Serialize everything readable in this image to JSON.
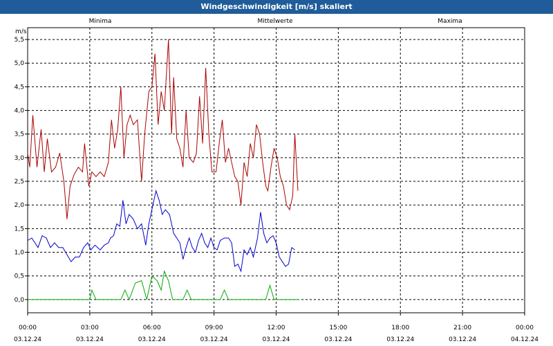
{
  "window": {
    "title": "Windgeschwindigkeit [m/s] skaliert"
  },
  "colors": {
    "titlebar": "#1f5c99",
    "minima": "#00aa00",
    "mittel": "#0000cc",
    "maxima": "#aa0000",
    "grid": "#000000"
  },
  "chart_data": {
    "type": "line",
    "title": "Windgeschwindigkeit [m/s] skaliert",
    "ylabel": "m/s",
    "xlabel": "",
    "ylim": [
      -0.28,
      5.75
    ],
    "xlim": [
      0,
      24
    ],
    "grid": true,
    "legend_placement": "top",
    "y_ticks": [
      "0,0",
      "0,5",
      "1,0",
      "1,5",
      "2,0",
      "2,5",
      "3,0",
      "3,5",
      "4,0",
      "4,5",
      "5,0",
      "5,5"
    ],
    "y_tick_values": [
      0,
      0.5,
      1,
      1.5,
      2,
      2.5,
      3,
      3.5,
      4,
      4.5,
      5,
      5.5
    ],
    "x_ticks": [
      {
        "time": "00:00",
        "date": "03.12.24"
      },
      {
        "time": "03:00",
        "date": "03.12.24"
      },
      {
        "time": "06:00",
        "date": "03.12.24"
      },
      {
        "time": "09:00",
        "date": "03.12.24"
      },
      {
        "time": "12:00",
        "date": "03.12.24"
      },
      {
        "time": "15:00",
        "date": "03.12.24"
      },
      {
        "time": "18:00",
        "date": "03.12.24"
      },
      {
        "time": "21:00",
        "date": "03.12.24"
      },
      {
        "time": "00:00",
        "date": "04.12.24"
      }
    ],
    "x_tick_values": [
      0,
      3,
      6,
      9,
      12,
      15,
      18,
      21,
      24
    ],
    "series": [
      {
        "name": "Minima",
        "color": "#00aa00",
        "points": [
          [
            0,
            0
          ],
          [
            3,
            0
          ],
          [
            3.1,
            0.2
          ],
          [
            3.3,
            0
          ],
          [
            4.5,
            0
          ],
          [
            4.7,
            0.2
          ],
          [
            4.9,
            0
          ],
          [
            5.2,
            0.35
          ],
          [
            5.5,
            0.4
          ],
          [
            5.75,
            0
          ],
          [
            6.0,
            0.5
          ],
          [
            6.25,
            0.4
          ],
          [
            6.45,
            0.2
          ],
          [
            6.6,
            0.6
          ],
          [
            6.8,
            0.4
          ],
          [
            7.0,
            0
          ],
          [
            7.5,
            0
          ],
          [
            7.7,
            0.2
          ],
          [
            7.9,
            0
          ],
          [
            9.3,
            0
          ],
          [
            9.5,
            0.2
          ],
          [
            9.7,
            0
          ],
          [
            11.5,
            0
          ],
          [
            11.7,
            0.3
          ],
          [
            11.9,
            0
          ],
          [
            13.1,
            0
          ]
        ]
      },
      {
        "name": "Mittelwerte",
        "color": "#0000cc",
        "points": [
          [
            0,
            1.25
          ],
          [
            0.2,
            1.3
          ],
          [
            0.35,
            1.2
          ],
          [
            0.5,
            1.1
          ],
          [
            0.7,
            1.35
          ],
          [
            0.9,
            1.3
          ],
          [
            1.1,
            1.1
          ],
          [
            1.3,
            1.2
          ],
          [
            1.5,
            1.1
          ],
          [
            1.7,
            1.1
          ],
          [
            1.9,
            0.95
          ],
          [
            2.1,
            0.8
          ],
          [
            2.3,
            0.9
          ],
          [
            2.5,
            0.9
          ],
          [
            2.7,
            1.1
          ],
          [
            2.9,
            1.2
          ],
          [
            3.05,
            1.05
          ],
          [
            3.25,
            1.15
          ],
          [
            3.5,
            1.05
          ],
          [
            3.7,
            1.15
          ],
          [
            3.9,
            1.2
          ],
          [
            4.0,
            1.3
          ],
          [
            4.15,
            1.35
          ],
          [
            4.3,
            1.6
          ],
          [
            4.45,
            1.55
          ],
          [
            4.6,
            2.1
          ],
          [
            4.75,
            1.6
          ],
          [
            4.9,
            1.8
          ],
          [
            5.1,
            1.7
          ],
          [
            5.3,
            1.5
          ],
          [
            5.5,
            1.6
          ],
          [
            5.7,
            1.15
          ],
          [
            5.85,
            1.6
          ],
          [
            6.05,
            2.0
          ],
          [
            6.2,
            2.3
          ],
          [
            6.35,
            2.1
          ],
          [
            6.5,
            1.8
          ],
          [
            6.65,
            1.9
          ],
          [
            6.85,
            1.8
          ],
          [
            7.05,
            1.4
          ],
          [
            7.2,
            1.3
          ],
          [
            7.35,
            1.2
          ],
          [
            7.5,
            0.85
          ],
          [
            7.65,
            1.1
          ],
          [
            7.8,
            1.3
          ],
          [
            7.95,
            1.1
          ],
          [
            8.1,
            1.0
          ],
          [
            8.25,
            1.25
          ],
          [
            8.4,
            1.4
          ],
          [
            8.55,
            1.2
          ],
          [
            8.7,
            1.1
          ],
          [
            8.85,
            1.3
          ],
          [
            9.0,
            1.1
          ],
          [
            9.15,
            1.05
          ],
          [
            9.3,
            1.25
          ],
          [
            9.5,
            1.3
          ],
          [
            9.7,
            1.3
          ],
          [
            9.85,
            1.2
          ],
          [
            10.0,
            0.7
          ],
          [
            10.15,
            0.75
          ],
          [
            10.3,
            0.6
          ],
          [
            10.45,
            1.05
          ],
          [
            10.6,
            0.95
          ],
          [
            10.75,
            1.1
          ],
          [
            10.9,
            0.9
          ],
          [
            11.1,
            1.3
          ],
          [
            11.25,
            1.85
          ],
          [
            11.4,
            1.4
          ],
          [
            11.55,
            1.2
          ],
          [
            11.7,
            1.3
          ],
          [
            11.85,
            1.35
          ],
          [
            12.0,
            1.2
          ],
          [
            12.15,
            0.9
          ],
          [
            12.3,
            0.8
          ],
          [
            12.45,
            0.7
          ],
          [
            12.6,
            0.75
          ],
          [
            12.75,
            1.1
          ],
          [
            12.9,
            1.05
          ]
        ]
      },
      {
        "name": "Maxima",
        "color": "#aa0000",
        "points": [
          [
            0,
            3.1
          ],
          [
            0.1,
            2.8
          ],
          [
            0.25,
            3.9
          ],
          [
            0.45,
            2.8
          ],
          [
            0.65,
            3.6
          ],
          [
            0.8,
            2.7
          ],
          [
            0.95,
            3.4
          ],
          [
            1.15,
            2.7
          ],
          [
            1.35,
            2.8
          ],
          [
            1.55,
            3.1
          ],
          [
            1.75,
            2.5
          ],
          [
            1.9,
            1.7
          ],
          [
            2.05,
            2.4
          ],
          [
            2.25,
            2.65
          ],
          [
            2.45,
            2.8
          ],
          [
            2.65,
            2.7
          ],
          [
            2.75,
            3.3
          ],
          [
            2.95,
            2.4
          ],
          [
            3.1,
            2.7
          ],
          [
            3.3,
            2.6
          ],
          [
            3.5,
            2.7
          ],
          [
            3.7,
            2.6
          ],
          [
            3.9,
            2.9
          ],
          [
            4.05,
            3.8
          ],
          [
            4.2,
            3.2
          ],
          [
            4.35,
            3.6
          ],
          [
            4.5,
            4.5
          ],
          [
            4.65,
            3.0
          ],
          [
            4.8,
            3.7
          ],
          [
            4.95,
            3.9
          ],
          [
            5.1,
            3.7
          ],
          [
            5.3,
            3.8
          ],
          [
            5.5,
            2.5
          ],
          [
            5.65,
            3.5
          ],
          [
            5.85,
            4.4
          ],
          [
            6.0,
            4.5
          ],
          [
            6.15,
            5.2
          ],
          [
            6.3,
            3.7
          ],
          [
            6.45,
            4.4
          ],
          [
            6.6,
            4.0
          ],
          [
            6.8,
            5.5
          ],
          [
            6.95,
            3.5
          ],
          [
            7.05,
            4.7
          ],
          [
            7.2,
            3.4
          ],
          [
            7.35,
            3.2
          ],
          [
            7.5,
            2.8
          ],
          [
            7.65,
            4.0
          ],
          [
            7.8,
            3.0
          ],
          [
            8.0,
            2.9
          ],
          [
            8.15,
            3.1
          ],
          [
            8.3,
            4.3
          ],
          [
            8.45,
            3.3
          ],
          [
            8.6,
            4.9
          ],
          [
            8.75,
            3.5
          ],
          [
            8.9,
            2.7
          ],
          [
            9.1,
            2.7
          ],
          [
            9.25,
            3.3
          ],
          [
            9.4,
            3.8
          ],
          [
            9.55,
            2.9
          ],
          [
            9.7,
            3.2
          ],
          [
            9.85,
            2.9
          ],
          [
            10.0,
            2.6
          ],
          [
            10.15,
            2.5
          ],
          [
            10.3,
            2.0
          ],
          [
            10.45,
            2.9
          ],
          [
            10.6,
            2.6
          ],
          [
            10.75,
            3.3
          ],
          [
            10.9,
            3.0
          ],
          [
            11.05,
            3.7
          ],
          [
            11.2,
            3.5
          ],
          [
            11.35,
            2.9
          ],
          [
            11.5,
            2.4
          ],
          [
            11.6,
            2.3
          ],
          [
            11.75,
            2.8
          ],
          [
            11.9,
            3.2
          ],
          [
            12.05,
            3.0
          ],
          [
            12.2,
            2.6
          ],
          [
            12.35,
            2.4
          ],
          [
            12.5,
            2.0
          ],
          [
            12.65,
            1.9
          ],
          [
            12.8,
            2.2
          ],
          [
            12.9,
            3.5
          ],
          [
            13.05,
            2.3
          ]
        ]
      }
    ]
  }
}
